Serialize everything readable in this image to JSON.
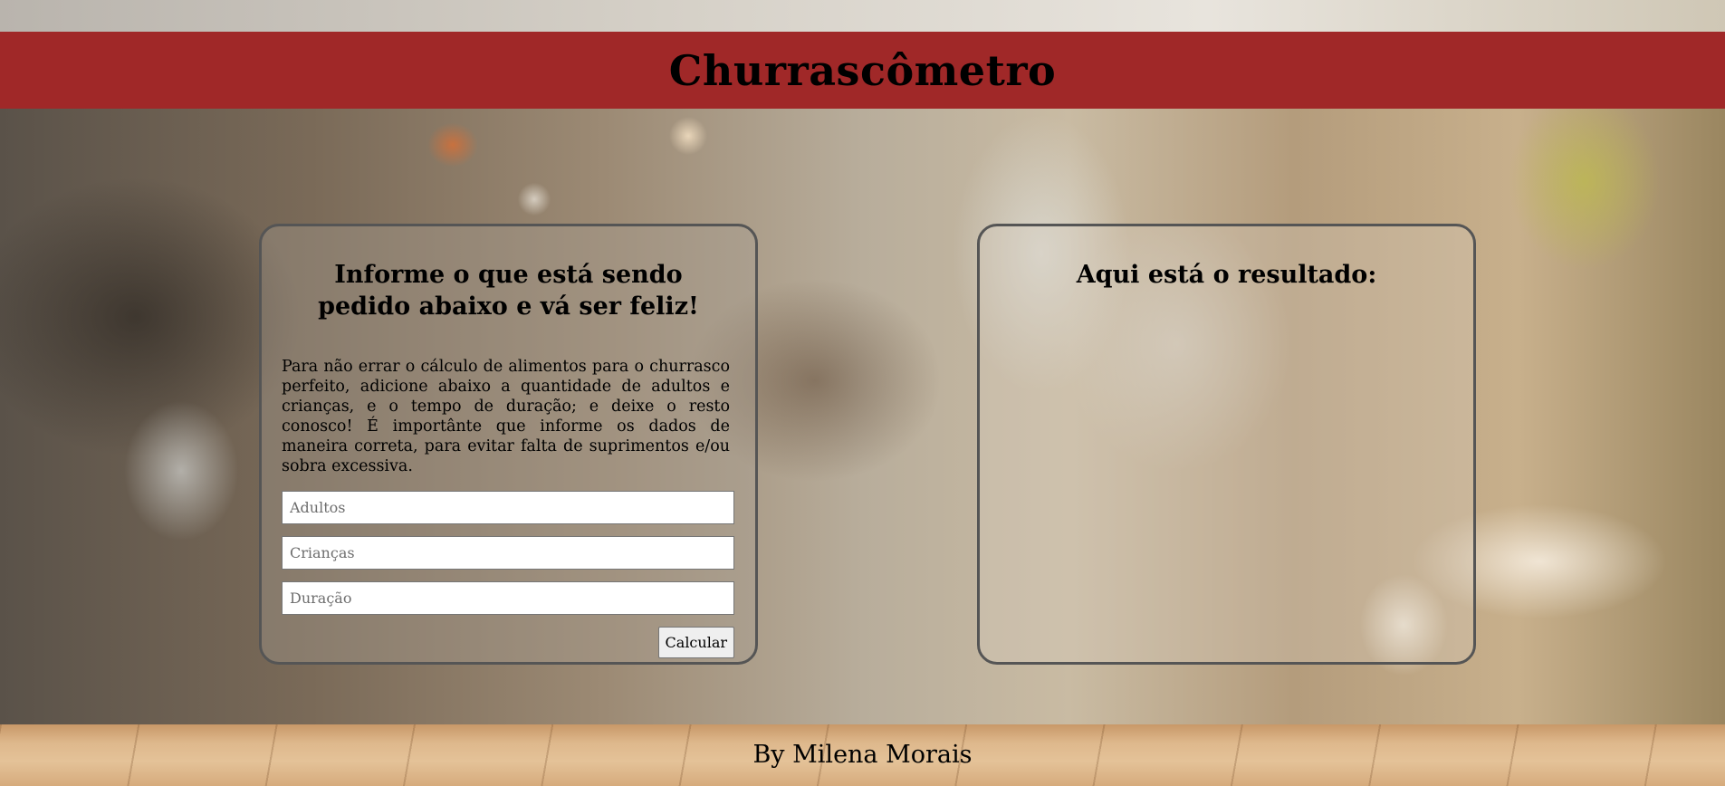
{
  "header": {
    "title": "Churrascômetro"
  },
  "form_card": {
    "heading": "Informe o que está sendo pedido abaixo e vá ser feliz!",
    "description": "Para não errar o cálculo de alimentos para o churrasco perfeito, adicione abaixo a quantidade de adultos e crianças, e o tempo de duração; e deixe o resto conosco! É importânte que informe os dados de maneira correta, para evitar falta de suprimentos e/ou sobra excessiva.",
    "inputs": {
      "adults": {
        "value": "",
        "placeholder": "Adultos"
      },
      "children": {
        "value": "",
        "placeholder": "Crianças"
      },
      "duration": {
        "value": "",
        "placeholder": "Duração"
      }
    },
    "calculate_label": "Calcular"
  },
  "result_card": {
    "heading": "Aqui está o resultado:"
  },
  "footer": {
    "text": "By Milena Morais"
  },
  "colors": {
    "header_bg": "#a02828",
    "card_border": "#555555"
  }
}
